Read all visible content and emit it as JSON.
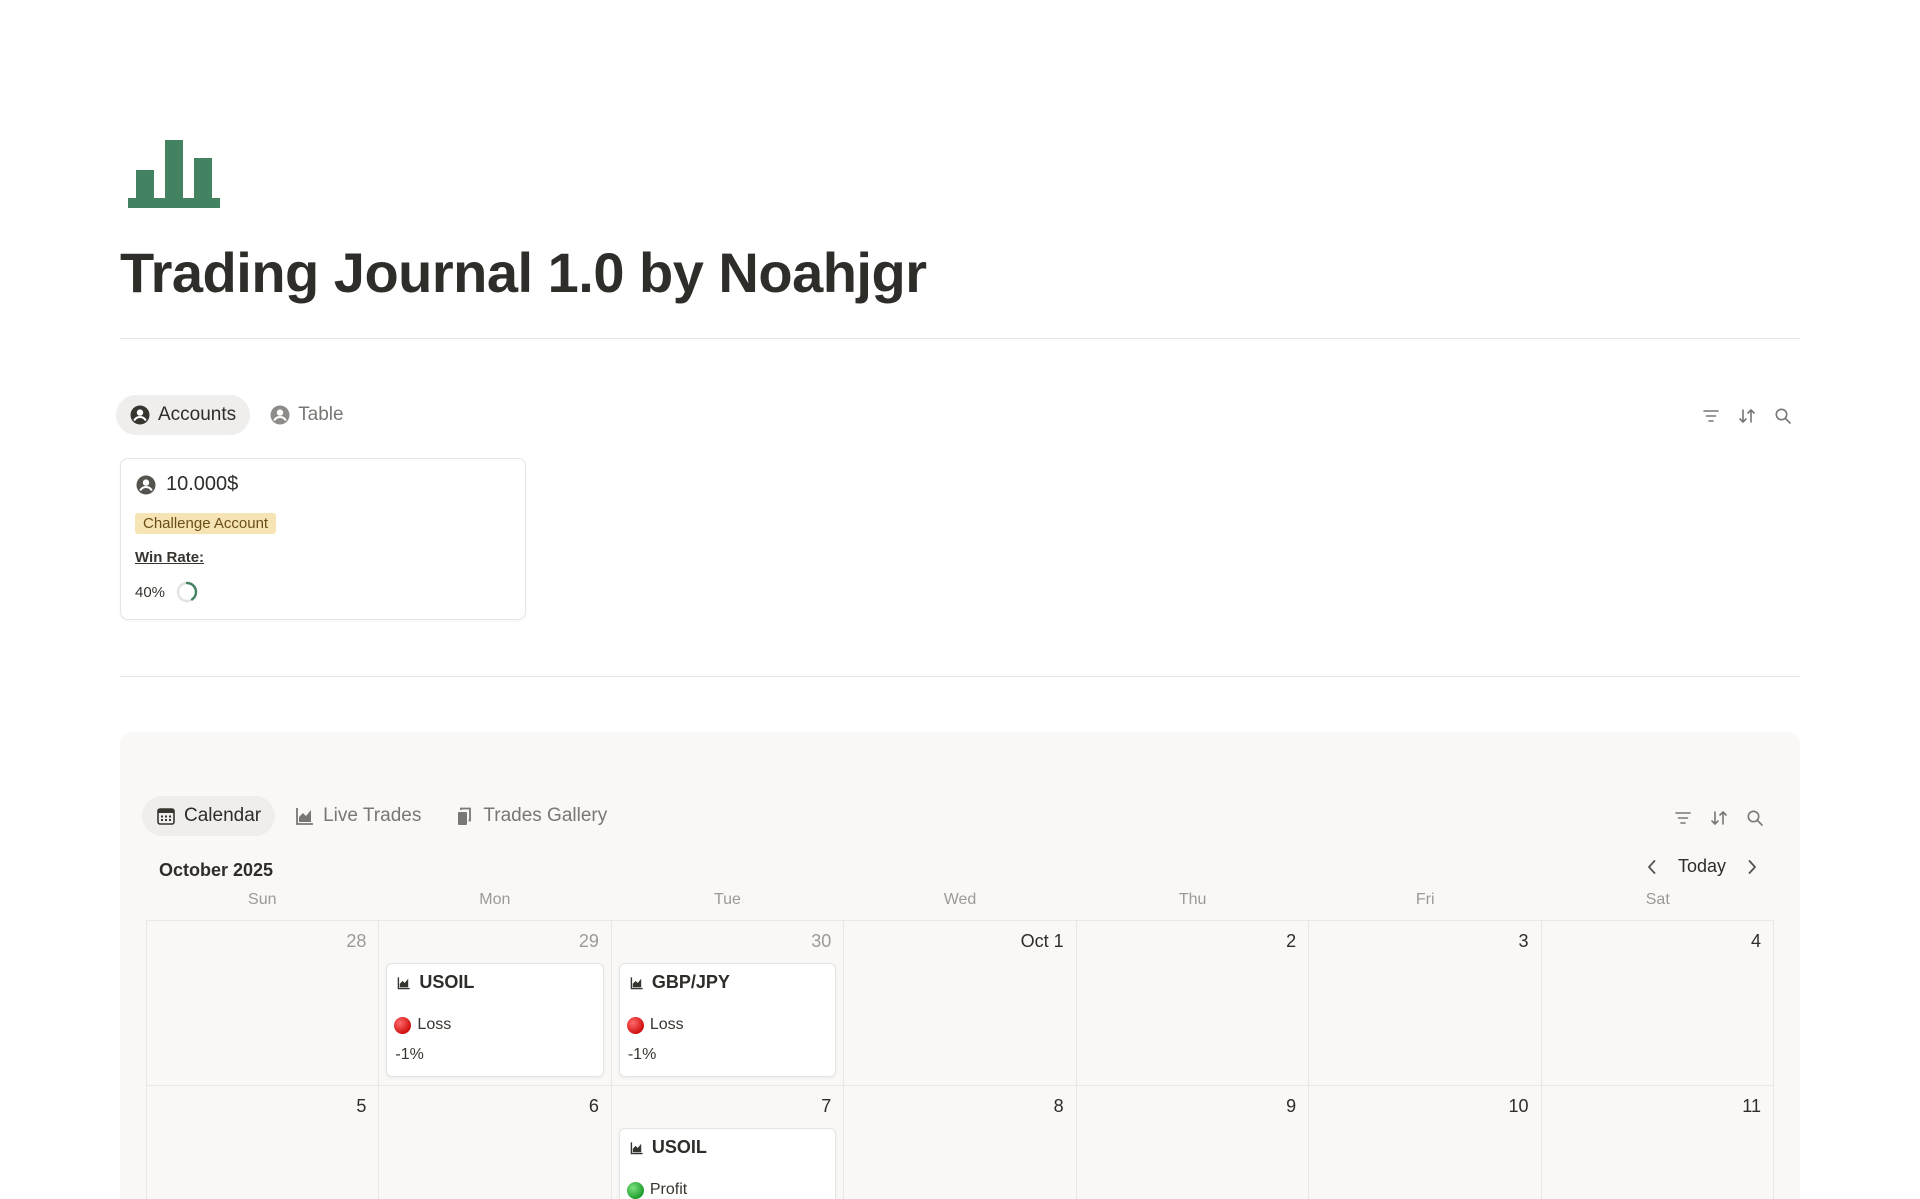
{
  "page": {
    "title": "Trading Journal 1.0 by Noahjgr",
    "icon": "bar-chart-icon",
    "accent_color": "#448361"
  },
  "accounts_view": {
    "tabs": [
      {
        "label": "Accounts",
        "icon": "person-circle-icon",
        "active": true
      },
      {
        "label": "Table",
        "icon": "person-circle-icon",
        "active": false
      }
    ],
    "tools": [
      "filter-icon",
      "sort-icon",
      "search-icon"
    ],
    "card": {
      "name": "10.000$",
      "tag": "Challenge Account",
      "tag_color": "#f6e4b5",
      "win_rate_label": "Win Rate:",
      "win_rate_text": "40%",
      "win_rate_value": 0.4
    }
  },
  "calendar_view": {
    "tabs": [
      {
        "label": "Calendar",
        "icon": "calendar-icon",
        "active": true
      },
      {
        "label": "Live Trades",
        "icon": "chart-icon",
        "active": false
      },
      {
        "label": "Trades Gallery",
        "icon": "gallery-icon",
        "active": false
      }
    ],
    "tools": [
      "filter-icon",
      "sort-icon",
      "search-icon"
    ],
    "month": "October 2025",
    "today_label": "Today",
    "weekdays": [
      "Sun",
      "Mon",
      "Tue",
      "Wed",
      "Thu",
      "Fri",
      "Sat"
    ],
    "weeks": [
      {
        "days": [
          {
            "num": "28",
            "muted": true
          },
          {
            "num": "29",
            "muted": true,
            "trade": {
              "title": "USOIL",
              "result": "Loss",
              "outcome": "loss",
              "pct": "-1%"
            }
          },
          {
            "num": "30",
            "muted": true,
            "trade": {
              "title": "GBP/JPY",
              "result": "Loss",
              "outcome": "loss",
              "pct": "-1%"
            }
          },
          {
            "num": "Oct 1"
          },
          {
            "num": "2"
          },
          {
            "num": "3"
          },
          {
            "num": "4"
          }
        ]
      },
      {
        "days": [
          {
            "num": "5"
          },
          {
            "num": "6"
          },
          {
            "num": "7",
            "trade": {
              "title": "USOIL",
              "result": "Profit",
              "outcome": "profit",
              "pct": ""
            }
          },
          {
            "num": "8"
          },
          {
            "num": "9"
          },
          {
            "num": "10"
          },
          {
            "num": "11"
          }
        ]
      }
    ]
  }
}
